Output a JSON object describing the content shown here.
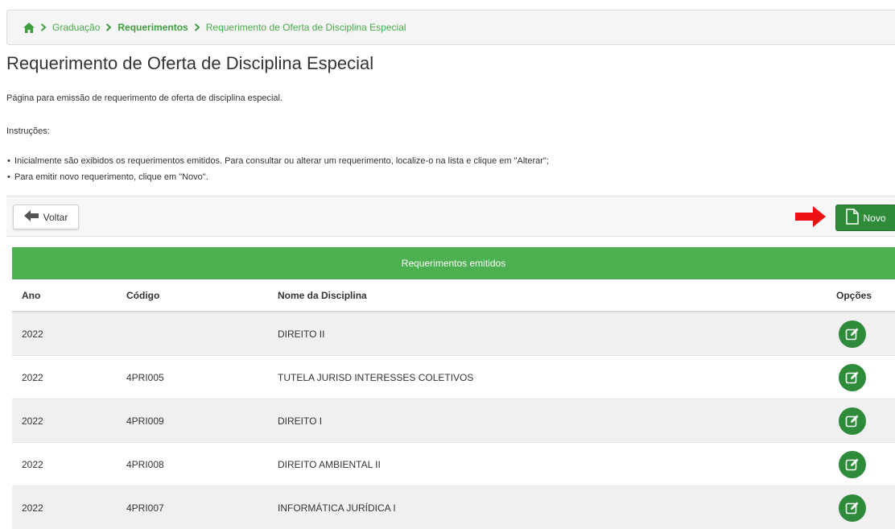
{
  "breadcrumb": {
    "home_icon": "home-icon",
    "items": [
      "Graduação",
      "Requerimentos",
      "Requerimento de Oferta de Disciplina Especial"
    ]
  },
  "page": {
    "title": "Requerimento de Oferta de Disciplina Especial",
    "description": "Página para emissão de requerimento de oferta de disciplina especial.",
    "instructions_title": "Instruções:",
    "instructions": [
      "Inicialmente são exibidos os requerimentos emitidos. Para consultar ou alterar um requerimento, localize-o na lista e clique em \"Alterar\";",
      "Para emitir novo requerimento, clique em \"Novo\"."
    ]
  },
  "toolbar": {
    "back_label": "Voltar",
    "new_label": "Novo"
  },
  "table": {
    "caption": "Requerimentos emitidos",
    "headers": [
      "Ano",
      "Código",
      "Nome da Disciplina",
      "Opções"
    ],
    "rows": [
      {
        "ano": "2022",
        "codigo": "",
        "nome": "DIREITO II"
      },
      {
        "ano": "2022",
        "codigo": "4PRI005",
        "nome": "TUTELA JURISD INTERESSES COLETIVOS"
      },
      {
        "ano": "2022",
        "codigo": "4PRI009",
        "nome": "DIREITO I"
      },
      {
        "ano": "2022",
        "codigo": "4PRI008",
        "nome": "DIREITO AMBIENTAL II"
      },
      {
        "ano": "2022",
        "codigo": "4PRI007",
        "nome": "INFORMÁTICA JURÍDICA I"
      }
    ]
  },
  "colors": {
    "accent_green": "#4caf50",
    "button_green": "#2e8b3a",
    "link_green": "#4aac4a",
    "arrow_red": "#ee1111"
  }
}
